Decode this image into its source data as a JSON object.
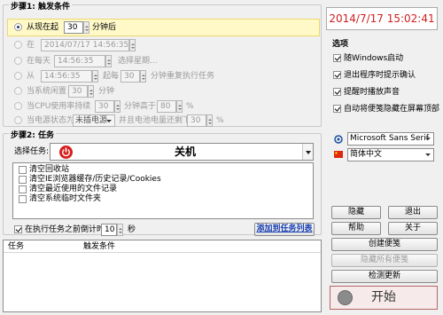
{
  "step1": {
    "legend": "步骤1: 触发条件",
    "row_from_now": {
      "label": "从现在起",
      "value": "30",
      "suffix": "分钟后"
    },
    "row_at": {
      "label": "在",
      "value": "2014/07/17  14:56:35"
    },
    "row_daily": {
      "label": "在每天",
      "value": "14:56:35",
      "link": "选择星期..."
    },
    "row_from": {
      "label": "从",
      "value": "14:56:35",
      "mid": "起每",
      "interval": "30",
      "suffix": "分钟重复执行任务"
    },
    "row_idle": {
      "label": "当系统闲置",
      "value": "30",
      "suffix": "分钟"
    },
    "row_cpu": {
      "label": "当CPU使用率持续",
      "value": "30",
      "mid": "分钟高于",
      "pct": "80",
      "suffix": "%"
    },
    "row_power": {
      "label": "当电源状态为",
      "select": "未插电源",
      "mid": "并且电池电量还剩下",
      "pct": "30",
      "suffix": "%"
    }
  },
  "clock": "2014/7/17  15:02:41",
  "options": {
    "title": "选项",
    "items": [
      {
        "label": "随Windows启动",
        "checked": true
      },
      {
        "label": "退出程序时提示确认",
        "checked": true
      },
      {
        "label": "提醒时播放声音",
        "checked": true
      },
      {
        "label": "自动将便笺隐藏在屏幕顶部",
        "checked": true
      }
    ],
    "font_select": "Microsoft Sans Serif",
    "language_select": "简体中文"
  },
  "step2": {
    "legend": "步骤2: 任务",
    "task_label": "选择任务:",
    "task_value": "关机",
    "clear_items": [
      "清空回收站",
      "清空IE浏览器缓存/历史记录/Cookies",
      "清空最近使用的文件记录",
      "清空系统临时文件夹"
    ],
    "countdown_label": "在执行任务之前倒计时",
    "countdown_value": "10",
    "countdown_unit": "秒",
    "add_link": "添加到任务列表"
  },
  "table": {
    "col_task": "任务",
    "col_trigger": "触发条件"
  },
  "buttons": {
    "hide": "隐藏",
    "exit": "退出",
    "help": "帮助",
    "about": "关于",
    "create_note": "创建便笺",
    "hide_all_notes": "隐藏所有便笺",
    "check_update": "检测更新",
    "start": "开始"
  }
}
